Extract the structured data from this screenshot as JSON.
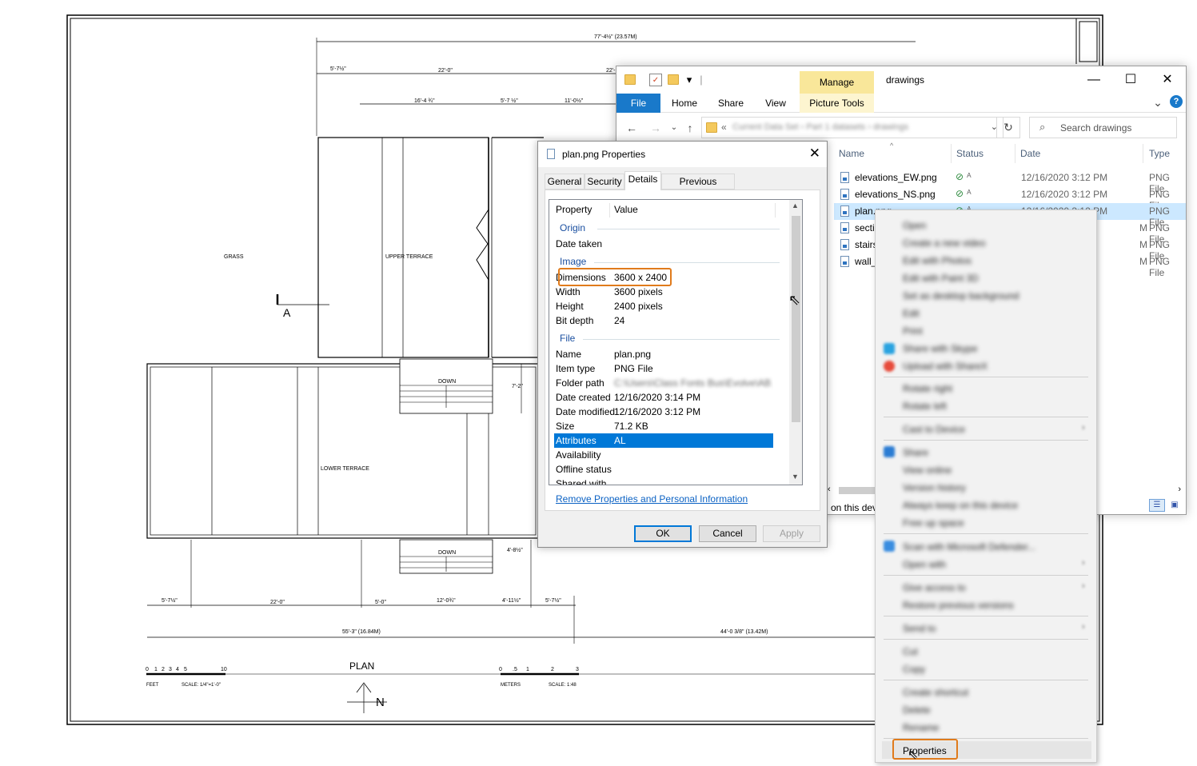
{
  "drawing": {
    "overall_dim": "77'-4½\" (23.57M)",
    "top_dims": [
      "5'-7½\"",
      "22'-0\"",
      "22'-"
    ],
    "upper_dims": [
      "16'-4 ¾\"",
      "5'-7 ½\"",
      "11'-0½\""
    ],
    "grass_label": "GRASS",
    "upper_terrace_label": "UPPER TERRACE",
    "lower_terrace_label": "LOWER TERRACE",
    "section_mark": "A",
    "down_label_1": "DOWN",
    "down_label_2": "DOWN",
    "stair_dim_1": "7'-2\"",
    "stair_dim_2": "4'-8½\"",
    "bottom_dims": [
      "5'-7½\"",
      "22'-0\"",
      "5'-0\"",
      "12'-0¾\"",
      "4'-11½\"",
      "5'-7½\""
    ],
    "total_left": "55'-3\" (16.84M)",
    "total_right": "44'-0 3/8\" (13.42M)",
    "plan_title": "PLAN",
    "scale_feet_ticks": [
      "0",
      "1",
      "2",
      "3",
      "4",
      "5",
      "10"
    ],
    "scale_feet_unit": "FEET",
    "scale_feet_text": "SCALE: 1/4\"=1'-0\"",
    "scale_m_ticks": [
      "0",
      ".5",
      "1",
      "2",
      "3"
    ],
    "scale_m_unit": "METERS",
    "scale_m_text": "SCALE: 1:48",
    "north_label": "N"
  },
  "explorer": {
    "title": "drawings",
    "manage_tab": "Manage",
    "ribbon_tabs": [
      "File",
      "Home",
      "Share",
      "View",
      "Picture Tools"
    ],
    "address_prefix": "«",
    "address_path_blurred": "Current Data Set  ›  Part 1 datasets  ›  drawings",
    "search_placeholder": "Search drawings",
    "columns": [
      "Name",
      "Status",
      "Date",
      "Type"
    ],
    "files": [
      {
        "name": "elevations_EW.png",
        "date": "12/16/2020 3:12 PM",
        "type": "PNG File"
      },
      {
        "name": "elevations_NS.png",
        "date": "12/16/2020 3:12 PM",
        "type": "PNG File"
      },
      {
        "name": "plan.png",
        "date": "12/16/2020 3:12 PM",
        "type": "PNG File"
      },
      {
        "name": "secti",
        "date": "M",
        "type": "PNG File"
      },
      {
        "name": "stairs",
        "date": "M",
        "type": "PNG File"
      },
      {
        "name": "wall_",
        "date": "M",
        "type": "PNG File"
      }
    ],
    "status_text": "on this dev"
  },
  "properties": {
    "title": "plan.png Properties",
    "tabs": [
      "General",
      "Security",
      "Details",
      "Previous Versions"
    ],
    "active_tab": "Details",
    "header_property": "Property",
    "header_value": "Value",
    "groups": {
      "origin": "Origin",
      "image": "Image",
      "file": "File"
    },
    "rows": {
      "date_taken": {
        "k": "Date taken",
        "v": ""
      },
      "dimensions": {
        "k": "Dimensions",
        "v": "3600 x 2400"
      },
      "width": {
        "k": "Width",
        "v": "3600 pixels"
      },
      "height": {
        "k": "Height",
        "v": "2400 pixels"
      },
      "bit_depth": {
        "k": "Bit depth",
        "v": "24"
      },
      "name": {
        "k": "Name",
        "v": "plan.png"
      },
      "item_type": {
        "k": "Item type",
        "v": "PNG File"
      },
      "folder_path": {
        "k": "Folder path",
        "v": "C:\\Users\\Class Fonts Bus\\Evolve\\AB ..."
      },
      "date_created": {
        "k": "Date created",
        "v": "12/16/2020 3:14 PM"
      },
      "date_modified": {
        "k": "Date modified",
        "v": "12/16/2020 3:12 PM"
      },
      "size": {
        "k": "Size",
        "v": "71.2 KB"
      },
      "attributes": {
        "k": "Attributes",
        "v": "AL"
      },
      "availability": {
        "k": "Availability",
        "v": ""
      },
      "offline_status": {
        "k": "Offline status",
        "v": ""
      },
      "shared_with": {
        "k": "Shared with",
        "v": ""
      }
    },
    "remove_link": "Remove Properties and Personal Information",
    "buttons": {
      "ok": "OK",
      "cancel": "Cancel",
      "apply": "Apply"
    }
  },
  "context_menu": {
    "items_blurred": [
      "Open",
      "Create a new video",
      "Edit with Photos",
      "Edit with Paint 3D",
      "Set as desktop background",
      "Edit",
      "Print",
      "Share with Skype",
      "Upload with ShareX",
      "Rotate right",
      "Rotate left",
      "Cast to Device",
      "Share",
      "View online",
      "Version history",
      "Always keep on this device",
      "Free up space",
      "Scan with Microsoft Defender...",
      "Open with",
      "Give access to",
      "Restore previous versions",
      "Send to",
      "Cut",
      "Copy",
      "Create shortcut",
      "Delete",
      "Rename"
    ],
    "properties": "Properties"
  },
  "colors": {
    "accent": "#1979ca",
    "highlight": "#e07b1c",
    "selection": "#0078d7",
    "manage_tab": "#f9e79a"
  }
}
